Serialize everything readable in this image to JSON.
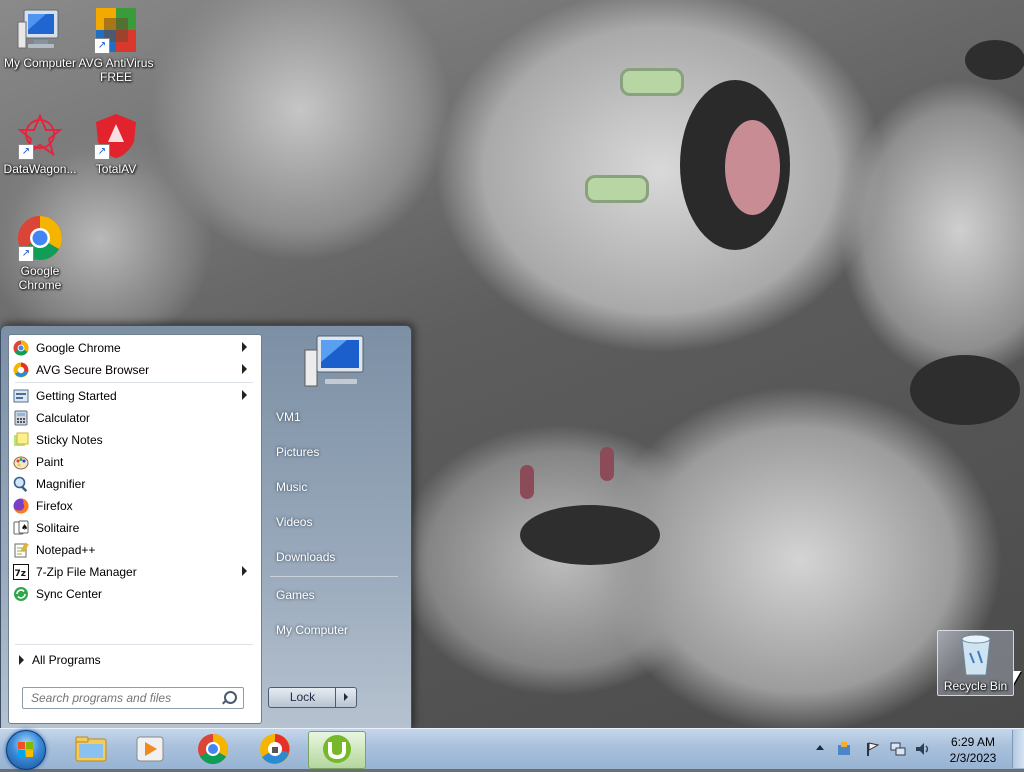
{
  "desktop": {
    "icons": [
      {
        "label": "My Computer",
        "icon": "computer-icon"
      },
      {
        "label": "AVG AntiVirus FREE",
        "icon": "avg-antivirus-icon"
      },
      {
        "label": "DataWagon...",
        "icon": "datawagon-icon"
      },
      {
        "label": "TotalAV",
        "icon": "totalav-icon"
      },
      {
        "label": "Google Chrome",
        "icon": "chrome-icon"
      },
      {
        "label": "Recycle Bin",
        "icon": "recycle-bin-icon"
      }
    ]
  },
  "start_menu": {
    "programs": [
      {
        "label": "Google Chrome",
        "icon": "chrome-icon",
        "submenu": true
      },
      {
        "label": "AVG Secure Browser",
        "icon": "avg-browser-icon",
        "submenu": true
      },
      {
        "label": "Getting Started",
        "icon": "getting-started-icon",
        "submenu": true
      },
      {
        "label": "Calculator",
        "icon": "calculator-icon",
        "submenu": false
      },
      {
        "label": "Sticky Notes",
        "icon": "sticky-notes-icon",
        "submenu": false
      },
      {
        "label": "Paint",
        "icon": "paint-icon",
        "submenu": false
      },
      {
        "label": "Magnifier",
        "icon": "magnifier-icon",
        "submenu": false
      },
      {
        "label": "Firefox",
        "icon": "firefox-icon",
        "submenu": false
      },
      {
        "label": "Solitaire",
        "icon": "solitaire-icon",
        "submenu": false
      },
      {
        "label": "Notepad++",
        "icon": "notepadpp-icon",
        "submenu": false
      },
      {
        "label": "7-Zip File Manager",
        "icon": "7zip-icon",
        "submenu": true
      },
      {
        "label": "Sync Center",
        "icon": "sync-center-icon",
        "submenu": false
      }
    ],
    "all_programs_label": "All Programs",
    "search_placeholder": "Search programs and files",
    "right_items": [
      {
        "label": "VM1"
      },
      {
        "label": "Pictures"
      },
      {
        "label": "Music"
      },
      {
        "label": "Videos"
      },
      {
        "label": "Downloads"
      },
      {
        "label": "Games"
      },
      {
        "label": "My Computer"
      }
    ],
    "lock_label": "Lock"
  },
  "taskbar": {
    "pinned": [
      {
        "icon": "file-explorer-icon"
      },
      {
        "icon": "media-player-icon"
      },
      {
        "icon": "chrome-icon"
      },
      {
        "icon": "avg-browser-icon"
      },
      {
        "icon": "utorrent-icon",
        "active": true
      }
    ],
    "clock_time": "6:29 AM",
    "clock_date": "2/3/2023"
  },
  "colors": {
    "taskbar": "#a8c0dc",
    "start_menu_right": "#8a9bb0",
    "utorrent_green": "#76b82a"
  }
}
